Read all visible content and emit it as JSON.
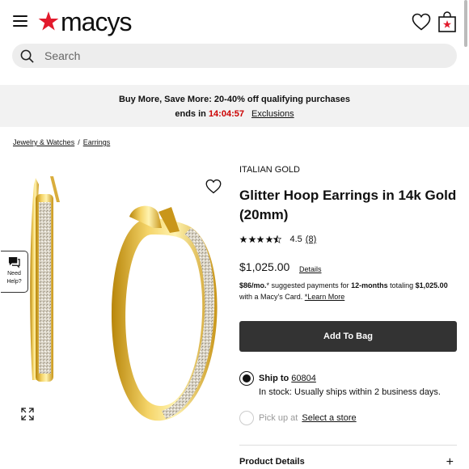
{
  "header": {
    "logo_text": "macys",
    "search_placeholder": "Search"
  },
  "promo": {
    "line1": "Buy More, Save More: 20-40% off qualifying purchases",
    "ends_label": "ends in",
    "timer": "14:04:57",
    "exclusions": "Exclusions"
  },
  "breadcrumb": {
    "items": [
      "Jewelry & Watches",
      "Earrings"
    ],
    "separator": "/"
  },
  "need_help": [
    "Need",
    "Help?"
  ],
  "product": {
    "brand": "ITALIAN GOLD",
    "title": "Glitter Hoop Earrings in 14k Gold (20mm)",
    "rating": "4.5",
    "rating_stars": 4.5,
    "reviews": "(8)",
    "price": "$1,025.00",
    "details_link": "Details",
    "financing": {
      "monthly": "$86/mo.",
      "asterisk": "*",
      "suggested": " suggested payments for ",
      "term": "12-months",
      "totaling": " totaling ",
      "total": "$1,025.00",
      "card_text": "with a Macy's Card. ",
      "learn_more": "*Learn More"
    },
    "add_to_bag": "Add To Bag",
    "ship": {
      "label": "Ship to",
      "zip": "60804",
      "stock": "In stock: Usually ships within 2 business days."
    },
    "pickup": {
      "label": "Pick up at",
      "store": "Select a store"
    },
    "section": "Product Details",
    "section_toggle": "+"
  },
  "colors": {
    "brand_red": "#e21a2c",
    "timer_red": "#cc0000",
    "button_bg": "#333333"
  }
}
